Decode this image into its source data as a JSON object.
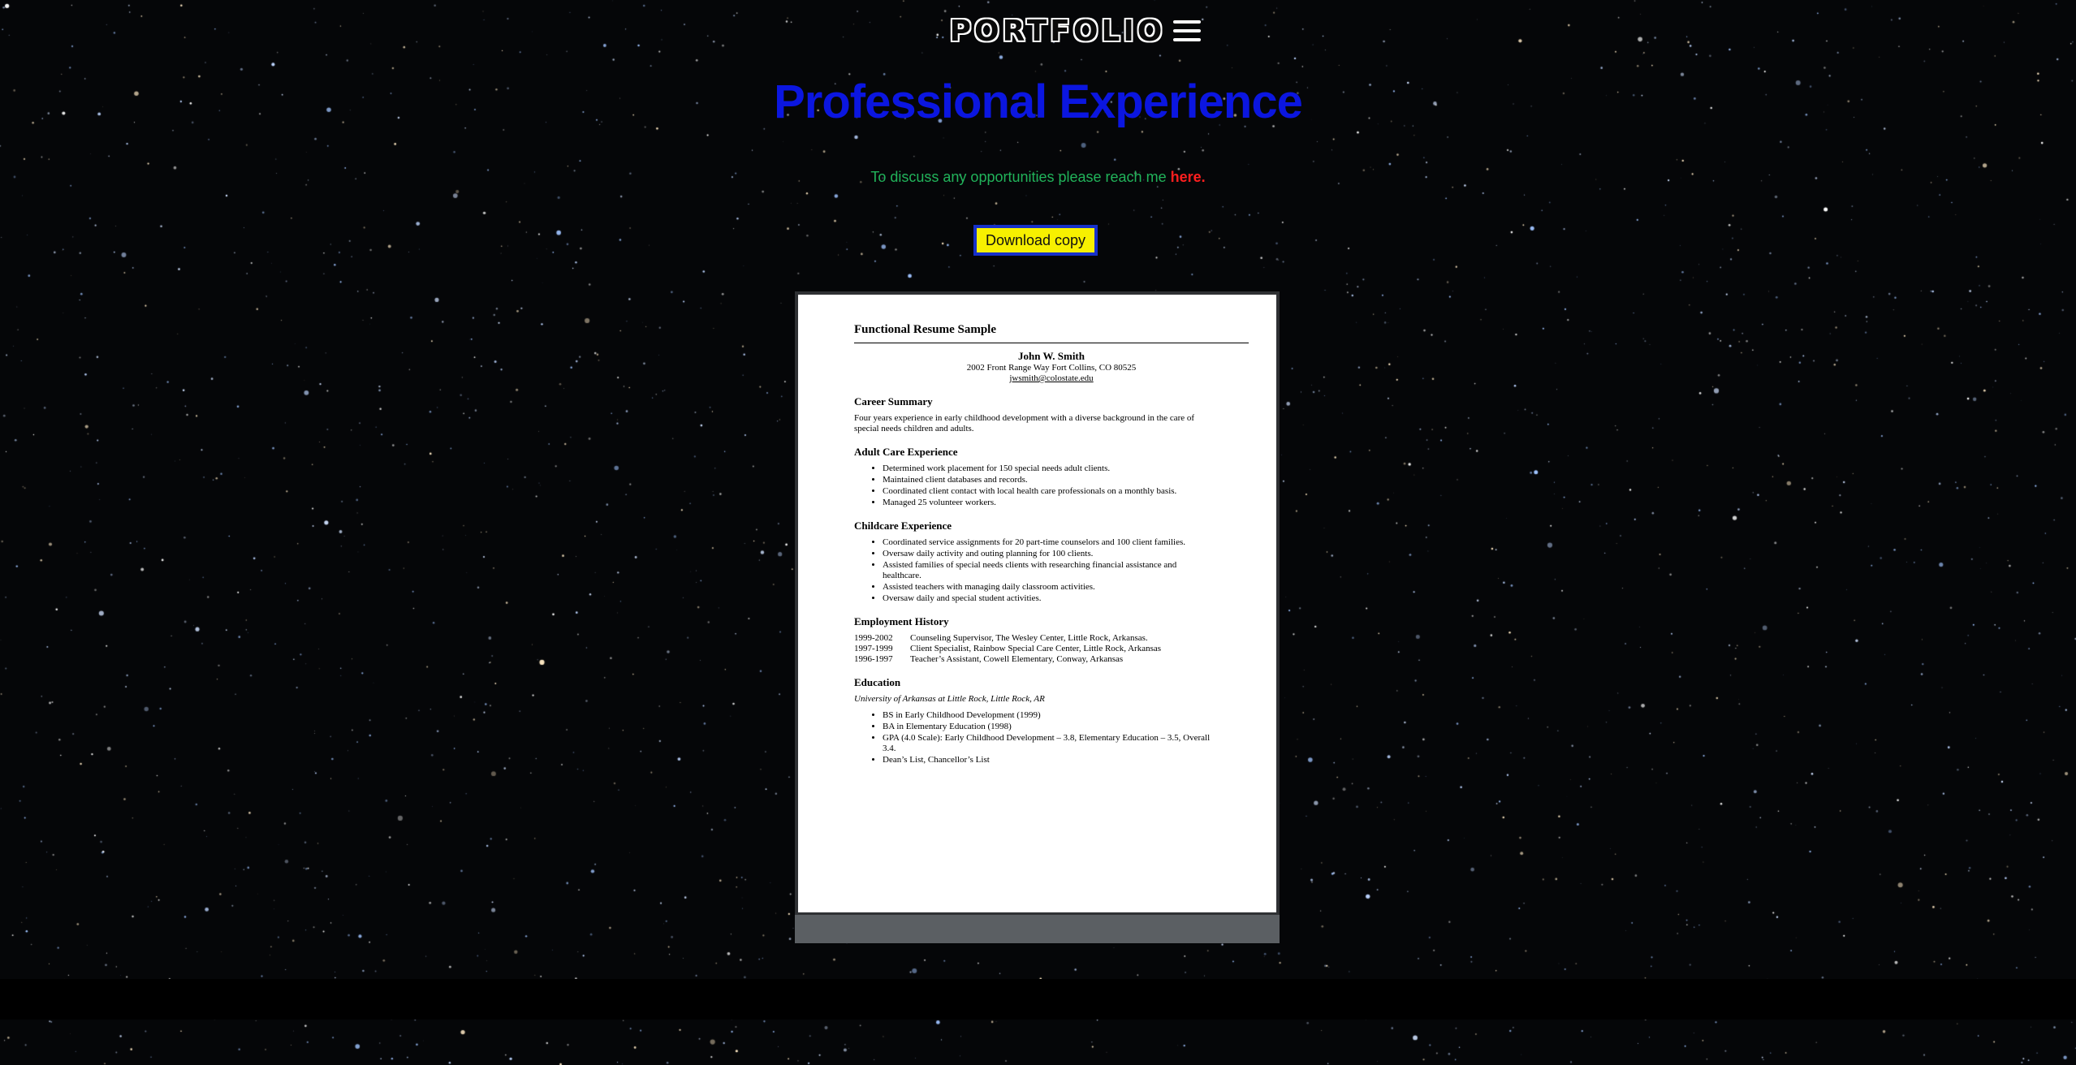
{
  "header": {
    "logo": "PORTFOLIO",
    "menu_icon": "hamburger-menu-icon"
  },
  "page": {
    "title": "Professional Experience",
    "contact_text": "To discuss any opportunities please reach me ",
    "contact_link": "here.",
    "download_label": "Download copy"
  },
  "colors": {
    "title": "#0b16e0",
    "contact_text": "#21b35a",
    "contact_link": "#ff1f1f",
    "button_bg": "#f7f000",
    "button_border": "#1630c9",
    "background": "#050608"
  },
  "resume": {
    "title": "Functional Resume Sample",
    "name": "John W. Smith",
    "address": "2002 Front Range Way Fort Collins, CO 80525",
    "email": "jwsmith@colostate.edu",
    "career_heading": "Career Summary",
    "career_text": "Four years experience in early childhood development with a diverse background in the care of special needs children and adults.",
    "adult_heading": "Adult Care Experience",
    "adult_items": [
      "Determined work placement for 150 special needs adult clients.",
      "Maintained client databases and records.",
      "Coordinated client contact with local health care professionals on a monthly basis.",
      "Managed 25 volunteer workers."
    ],
    "child_heading": "Childcare Experience",
    "child_items": [
      "Coordinated service assignments for 20 part-time counselors and 100 client families.",
      "Oversaw daily activity and outing planning for 100 clients.",
      "Assisted families of special needs clients with researching financial assistance and healthcare.",
      "Assisted teachers with managing daily classroom activities.",
      "Oversaw daily and special student activities."
    ],
    "employment_heading": "Employment History",
    "employment": [
      {
        "years": "1999-2002",
        "role": "Counseling Supervisor, The Wesley Center, Little Rock, Arkansas."
      },
      {
        "years": "1997-1999",
        "role": "Client Specialist, Rainbow Special Care Center, Little Rock, Arkansas"
      },
      {
        "years": "1996-1997",
        "role": "Teacher’s Assistant, Cowell Elementary, Conway, Arkansas"
      }
    ],
    "education_heading": "Education",
    "education_school": "University of Arkansas at Little Rock, Little Rock, AR",
    "education_items": [
      "BS in Early Childhood Development (1999)",
      "BA in Elementary Education (1998)",
      "GPA (4.0 Scale):  Early Childhood Development – 3.8, Elementary Education – 3.5, Overall 3.4.",
      "Dean’s List, Chancellor’s List"
    ]
  }
}
